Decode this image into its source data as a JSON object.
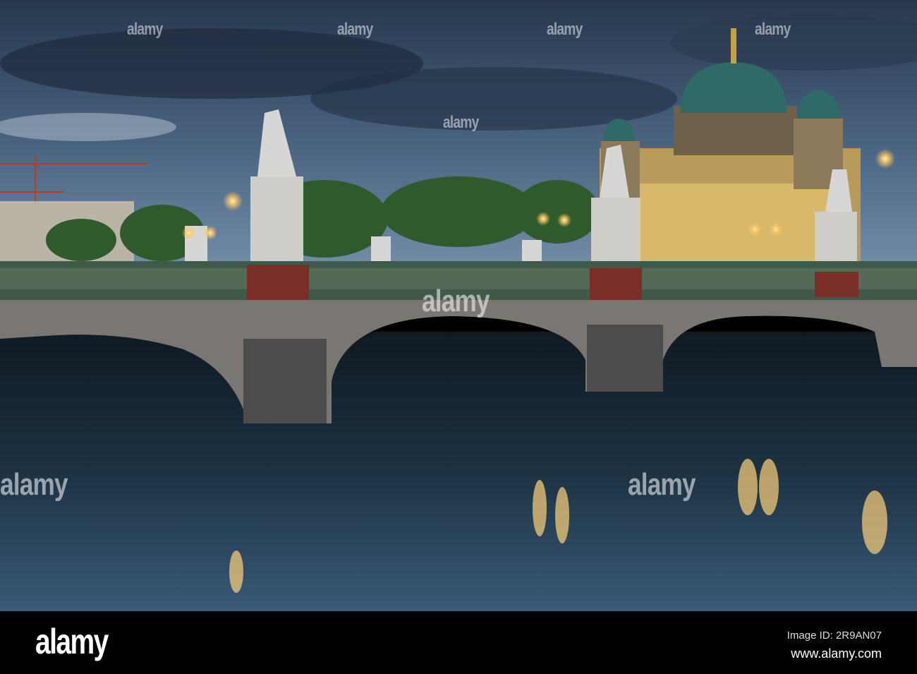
{
  "photo": {
    "subject": "Berlin Cathedral and Schlossbrücke at dusk",
    "colors": {
      "sky_top": "#2a3a52",
      "sky_bottom": "#6f8aa8",
      "water": "#1e3040",
      "stone": "#6d6a66",
      "rail": "#3f5a48",
      "lamp": "#ffd27a",
      "dome": "#2f6b66"
    }
  },
  "watermark": {
    "text": "alamy"
  },
  "footer": {
    "logo": "alamy",
    "image_id": "Image ID: 2R9AN07",
    "website": "www.alamy.com"
  }
}
